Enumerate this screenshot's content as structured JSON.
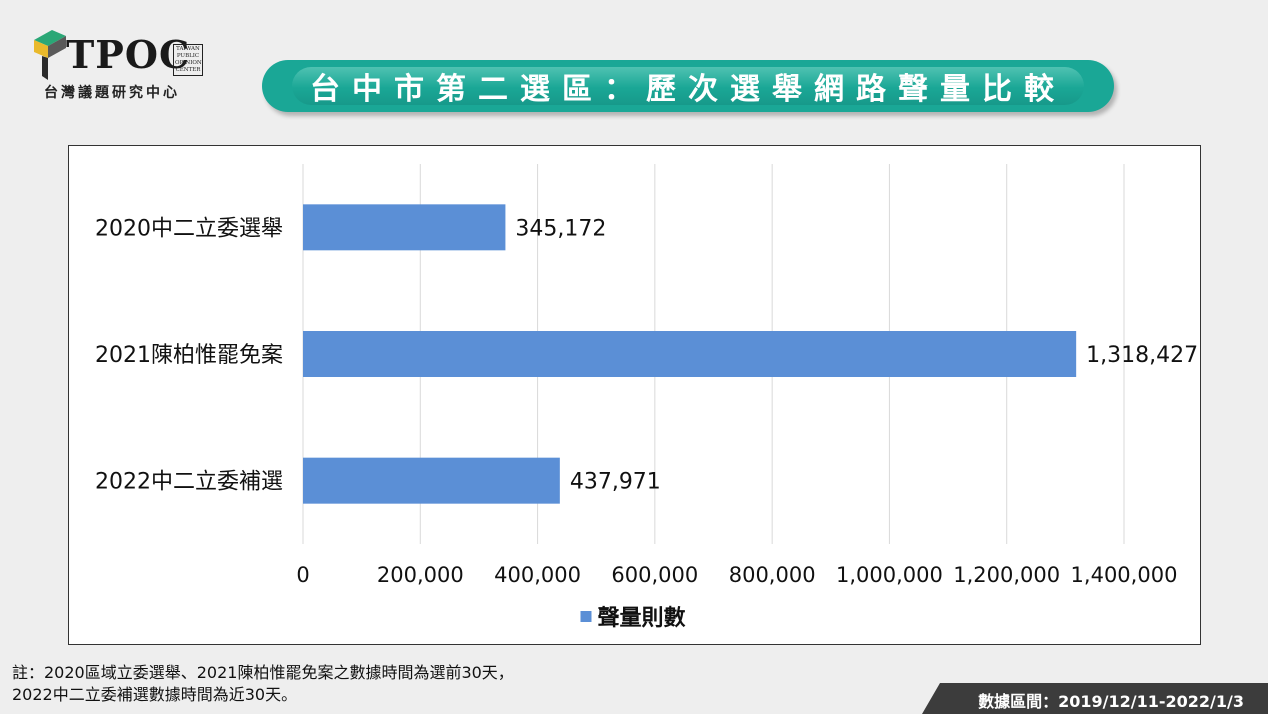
{
  "logo": {
    "brand": "TPOC",
    "side_lines": [
      "TAIWAN",
      "PUBLIC",
      "OPINION",
      "CENTER"
    ],
    "subtitle": "台灣議題研究中心",
    "colors": {
      "green": "#2aa776",
      "yellow": "#e9b92b",
      "gray": "#5a5a5a"
    }
  },
  "title": "台中市第二選區：歷次選舉網路聲量比較",
  "chart_data": {
    "type": "bar",
    "orientation": "horizontal",
    "categories": [
      "2020中二立委選舉",
      "2021陳柏惟罷免案",
      "2022中二立委補選"
    ],
    "series": [
      {
        "name": "聲量則數",
        "values": [
          345172,
          1318427,
          437971
        ],
        "color": "#5b8fd6"
      }
    ],
    "data_labels": [
      "345,172",
      "1,318,427",
      "437,971"
    ],
    "x_ticks": [
      0,
      200000,
      400000,
      600000,
      800000,
      1000000,
      1200000,
      1400000
    ],
    "x_tick_labels": [
      "0",
      "200,000",
      "400,000",
      "600,000",
      "800,000",
      "1,000,000",
      "1,200,000",
      "1,400,000"
    ],
    "xlim": [
      0,
      1400000
    ],
    "grid": "vertical",
    "legend": "bottom-center"
  },
  "note": {
    "line1": "註：2020區域立委選舉、2021陳柏惟罷免案之數據時間為選前30天，",
    "line2": "2022中二立委補選數據時間為近30天。"
  },
  "data_range": "數據區間：2019/12/11-2022/1/3"
}
